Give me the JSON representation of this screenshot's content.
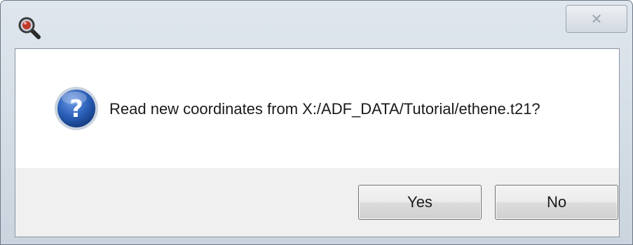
{
  "window": {
    "app_icon": "magnifier-icon",
    "close_icon": "close-icon",
    "close_glyph": "✕"
  },
  "dialog": {
    "icon": "question-icon",
    "message": "Read new coordinates from X:/ADF_DATA/Tutorial/ethene.t21?",
    "buttons": {
      "yes_label": "Yes",
      "no_label": "No"
    }
  },
  "colors": {
    "question_icon_blue": "#2a5fb8",
    "title_bar": "#d7dee7"
  }
}
